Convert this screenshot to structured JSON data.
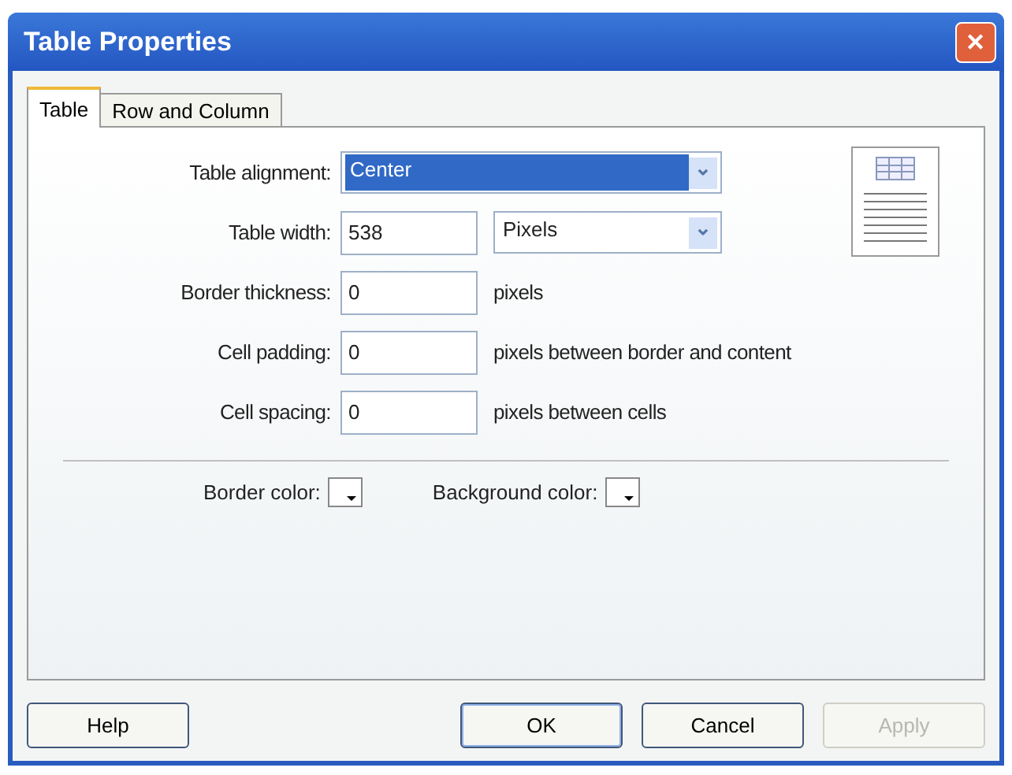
{
  "window": {
    "title": "Table Properties",
    "close": "✕"
  },
  "tabs": [
    {
      "label": "Table",
      "selected": true
    },
    {
      "label": "Row and Column",
      "selected": false
    }
  ],
  "fields": [
    {
      "kind": "select",
      "label": "Table alignment:",
      "value": "Center",
      "focused": true,
      "arrow": "⌄"
    },
    {
      "kind": "input_select",
      "label": "Table width:",
      "value": "538",
      "unit": "Pixels",
      "arrow": "⌄"
    },
    {
      "kind": "input",
      "label": "Border thickness:",
      "value": "0",
      "note": "pixels"
    },
    {
      "kind": "input",
      "label": "Cell padding:",
      "value": "0",
      "note": "pixels between border and content"
    },
    {
      "kind": "input",
      "label": "Cell spacing:",
      "value": "0",
      "note": "pixels between cells"
    }
  ],
  "colors": [
    {
      "label": "Border color:"
    },
    {
      "label": "Background color:"
    }
  ],
  "buttons": [
    {
      "label": "Help",
      "disabled": false,
      "default": false
    },
    {
      "label": "OK",
      "disabled": false,
      "default": true
    },
    {
      "label": "Cancel",
      "disabled": false,
      "default": false
    },
    {
      "label": "Apply",
      "disabled": true,
      "default": false
    }
  ]
}
